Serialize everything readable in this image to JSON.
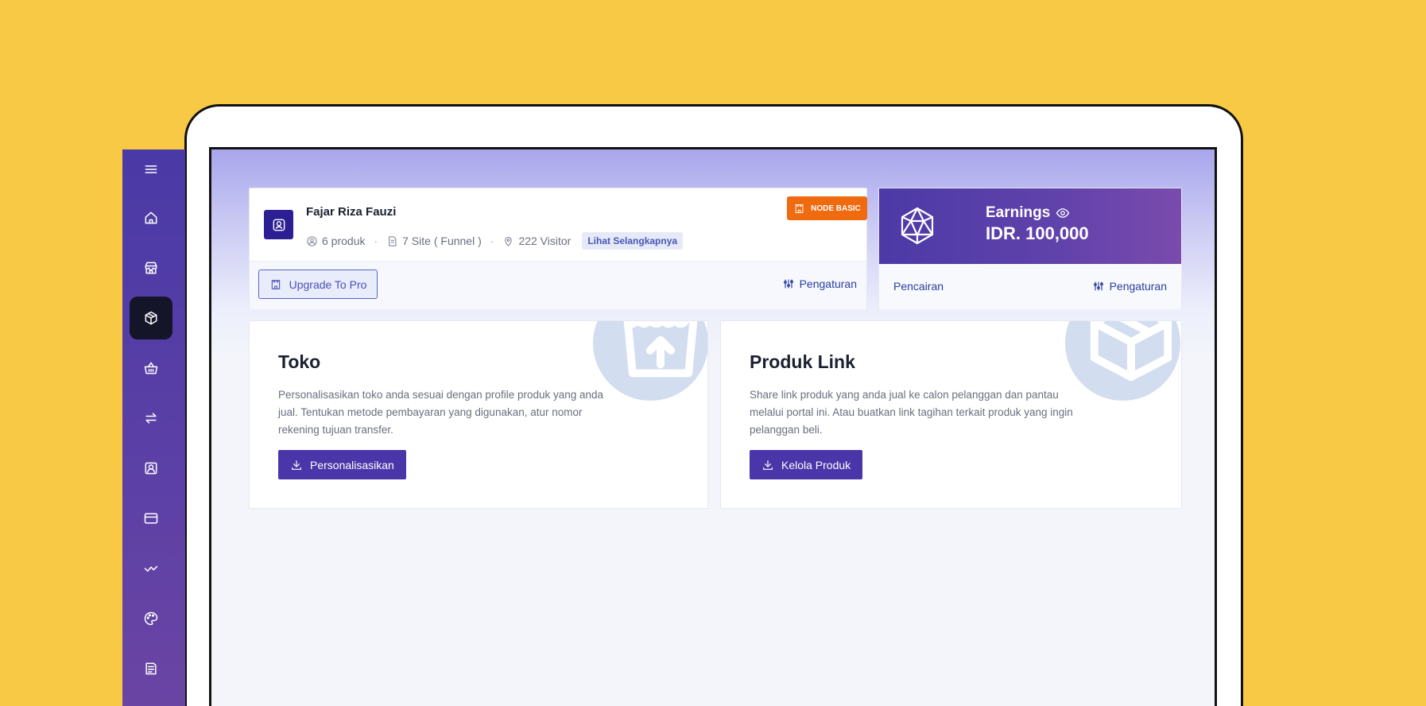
{
  "sidebar": {
    "items": [
      {
        "icon": "menu-icon",
        "active": false
      },
      {
        "icon": "home-icon",
        "active": false
      },
      {
        "icon": "store-icon",
        "active": false
      },
      {
        "icon": "box-icon",
        "active": true
      },
      {
        "icon": "basket-icon",
        "active": false
      },
      {
        "icon": "transfer-icon",
        "active": false
      },
      {
        "icon": "user-square-icon",
        "active": false
      },
      {
        "icon": "card-icon",
        "active": false
      },
      {
        "icon": "activity-icon",
        "active": false
      },
      {
        "icon": "palette-icon",
        "active": false
      },
      {
        "icon": "document-icon",
        "active": false
      }
    ]
  },
  "profile": {
    "name": "Fajar Riza Fauzi",
    "products": "6 produk",
    "sites": "7 Site ( Funnel )",
    "visitors": "222 Visitor",
    "more_label": "Lihat Selangkapnya",
    "plan_badge": "NODE BASIC",
    "upgrade_label": "Upgrade To Pro",
    "settings_label": "Pengaturan"
  },
  "earnings": {
    "label": "Earnings",
    "value": "IDR. 100,000",
    "withdraw_label": "Pencairan",
    "settings_label": "Pengaturan"
  },
  "cards": {
    "toko": {
      "title": "Toko",
      "description": "Personalisasikan toko anda sesuai dengan profile produk yang anda jual. Tentukan metode pembayaran yang digunakan, atur nomor rekening tujuan transfer.",
      "button_label": "Personalisasikan"
    },
    "produk": {
      "title": "Produk Link",
      "description": "Share link produk yang anda jual ke calon pelanggan dan pantau melalui portal ini. Atau buatkan link tagihan terkait produk yang ingin pelanggan beli.",
      "button_label": "Kelola Produk"
    }
  },
  "colors": {
    "background": "#f8c944",
    "sidebar": "#4a3aa6",
    "primary": "#4a36a8",
    "plan_badge": "#f06a10",
    "link": "#2a3ea0"
  }
}
